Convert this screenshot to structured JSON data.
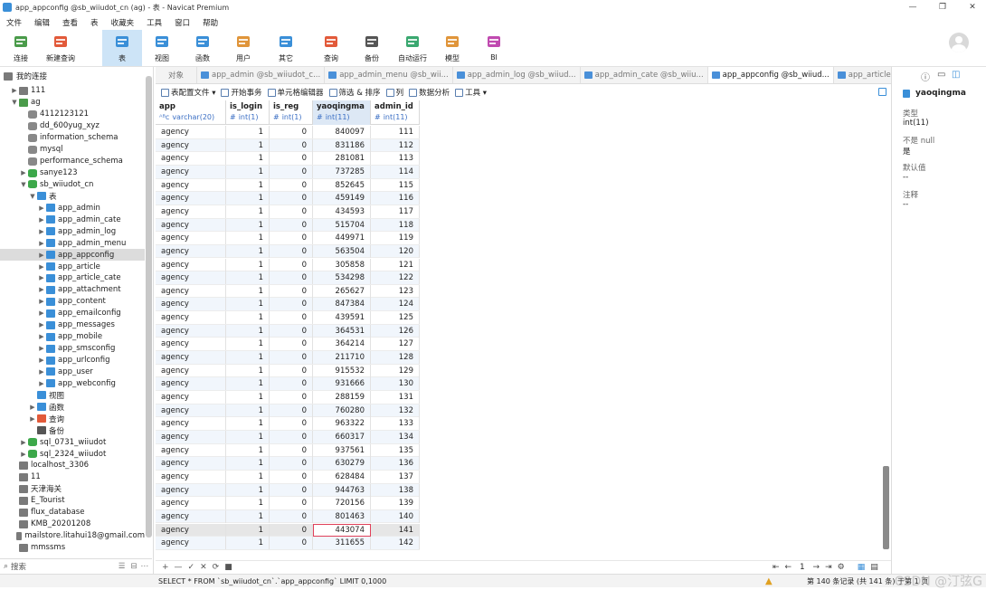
{
  "window": {
    "title": "app_appconfig @sb_wiiudot_cn (ag) - 表 - Navicat Premium"
  },
  "menu": [
    "文件",
    "编辑",
    "查看",
    "表",
    "收藏夹",
    "工具",
    "窗口",
    "帮助"
  ],
  "toolbar": [
    {
      "label": "连接",
      "icon": "connection-icon",
      "color": "#4a9b4a"
    },
    {
      "label": "新建查询",
      "icon": "new-query-icon",
      "color": "#e25a3a"
    },
    {
      "label": "表",
      "icon": "table-icon",
      "color": "#3a8fd8"
    },
    {
      "label": "视图",
      "icon": "view-icon",
      "color": "#3a8fd8"
    },
    {
      "label": "函数",
      "icon": "function-icon",
      "color": "#3a8fd8"
    },
    {
      "label": "用户",
      "icon": "user-icon",
      "color": "#e0953a"
    },
    {
      "label": "其它",
      "icon": "tools-icon",
      "color": "#3a8fd8"
    },
    {
      "label": "查询",
      "icon": "query-icon",
      "color": "#e25a3a"
    },
    {
      "label": "备份",
      "icon": "backup-icon",
      "color": "#555555"
    },
    {
      "label": "自动运行",
      "icon": "robot-icon",
      "color": "#3aa870"
    },
    {
      "label": "模型",
      "icon": "model-icon",
      "color": "#e0953a"
    },
    {
      "label": "BI",
      "icon": "bi-icon",
      "color": "#c04ab0"
    }
  ],
  "sidebar": {
    "header": "我的连接",
    "search_placeholder": "搜索",
    "nodes": [
      {
        "label": "111",
        "indent": 0,
        "arrow": "▶",
        "icon": "conn",
        "color": "#7a7a7a"
      },
      {
        "label": "ag",
        "indent": 0,
        "arrow": "▼",
        "icon": "conn",
        "color": "#4a9b4a"
      },
      {
        "label": "4112123121",
        "indent": 1,
        "arrow": "",
        "icon": "db",
        "color": "#888"
      },
      {
        "label": "dd_600yug_xyz",
        "indent": 1,
        "arrow": "",
        "icon": "db",
        "color": "#888"
      },
      {
        "label": "information_schema",
        "indent": 1,
        "arrow": "",
        "icon": "db",
        "color": "#888"
      },
      {
        "label": "mysql",
        "indent": 1,
        "arrow": "",
        "icon": "db",
        "color": "#888"
      },
      {
        "label": "performance_schema",
        "indent": 1,
        "arrow": "",
        "icon": "db",
        "color": "#888"
      },
      {
        "label": "sanye123",
        "indent": 1,
        "arrow": "▶",
        "icon": "db",
        "color": "#3ca84a"
      },
      {
        "label": "sb_wiiudot_cn",
        "indent": 1,
        "arrow": "▼",
        "icon": "db",
        "color": "#3ca84a"
      },
      {
        "label": "表",
        "indent": 2,
        "arrow": "▼",
        "icon": "folder",
        "color": "#3a8fd8"
      },
      {
        "label": "app_admin",
        "indent": 3,
        "arrow": "▶",
        "icon": "table",
        "color": "#3a8fd8"
      },
      {
        "label": "app_admin_cate",
        "indent": 3,
        "arrow": "▶",
        "icon": "table",
        "color": "#3a8fd8"
      },
      {
        "label": "app_admin_log",
        "indent": 3,
        "arrow": "▶",
        "icon": "table",
        "color": "#3a8fd8"
      },
      {
        "label": "app_admin_menu",
        "indent": 3,
        "arrow": "▶",
        "icon": "table",
        "color": "#3a8fd8"
      },
      {
        "label": "app_appconfig",
        "indent": 3,
        "arrow": "▶",
        "icon": "table",
        "color": "#3a8fd8",
        "selected": true
      },
      {
        "label": "app_article",
        "indent": 3,
        "arrow": "▶",
        "icon": "table",
        "color": "#3a8fd8"
      },
      {
        "label": "app_article_cate",
        "indent": 3,
        "arrow": "▶",
        "icon": "table",
        "color": "#3a8fd8"
      },
      {
        "label": "app_attachment",
        "indent": 3,
        "arrow": "▶",
        "icon": "table",
        "color": "#3a8fd8"
      },
      {
        "label": "app_content",
        "indent": 3,
        "arrow": "▶",
        "icon": "table",
        "color": "#3a8fd8"
      },
      {
        "label": "app_emailconfig",
        "indent": 3,
        "arrow": "▶",
        "icon": "table",
        "color": "#3a8fd8"
      },
      {
        "label": "app_messages",
        "indent": 3,
        "arrow": "▶",
        "icon": "table",
        "color": "#3a8fd8"
      },
      {
        "label": "app_mobile",
        "indent": 3,
        "arrow": "▶",
        "icon": "table",
        "color": "#3a8fd8"
      },
      {
        "label": "app_smsconfig",
        "indent": 3,
        "arrow": "▶",
        "icon": "table",
        "color": "#3a8fd8"
      },
      {
        "label": "app_urlconfig",
        "indent": 3,
        "arrow": "▶",
        "icon": "table",
        "color": "#3a8fd8"
      },
      {
        "label": "app_user",
        "indent": 3,
        "arrow": "▶",
        "icon": "table",
        "color": "#3a8fd8"
      },
      {
        "label": "app_webconfig",
        "indent": 3,
        "arrow": "▶",
        "icon": "table",
        "color": "#3a8fd8"
      },
      {
        "label": "视图",
        "indent": 2,
        "arrow": "",
        "icon": "view",
        "color": "#3a8fd8"
      },
      {
        "label": "函数",
        "indent": 2,
        "arrow": "▶",
        "icon": "func",
        "color": "#3a8fd8"
      },
      {
        "label": "查询",
        "indent": 2,
        "arrow": "▶",
        "icon": "query",
        "color": "#e25a3a"
      },
      {
        "label": "备份",
        "indent": 2,
        "arrow": "",
        "icon": "backup",
        "color": "#555"
      },
      {
        "label": "sql_0731_wiiudot",
        "indent": 1,
        "arrow": "▶",
        "icon": "db",
        "color": "#3ca84a"
      },
      {
        "label": "sql_2324_wiiudot",
        "indent": 1,
        "arrow": "▶",
        "icon": "db",
        "color": "#3ca84a"
      },
      {
        "label": "localhost_3306",
        "indent": 0,
        "arrow": "",
        "icon": "conn",
        "color": "#7a7a7a"
      },
      {
        "label": "11",
        "indent": 0,
        "arrow": "",
        "icon": "conn",
        "color": "#7a7a7a"
      },
      {
        "label": "天津海关",
        "indent": 0,
        "arrow": "",
        "icon": "conn",
        "color": "#7a7a7a"
      },
      {
        "label": "E_Tourist",
        "indent": 0,
        "arrow": "",
        "icon": "conn",
        "color": "#7a7a7a"
      },
      {
        "label": "flux_database",
        "indent": 0,
        "arrow": "",
        "icon": "conn",
        "color": "#7a7a7a"
      },
      {
        "label": "KMB_20201208",
        "indent": 0,
        "arrow": "",
        "icon": "conn",
        "color": "#7a7a7a"
      },
      {
        "label": "mailstore.litahui18@gmail.com",
        "indent": 0,
        "arrow": "",
        "icon": "conn",
        "color": "#7a7a7a"
      },
      {
        "label": "mmssms",
        "indent": 0,
        "arrow": "",
        "icon": "conn",
        "color": "#7a7a7a"
      }
    ]
  },
  "tabs": [
    {
      "label": "对象",
      "active": false,
      "icon": false
    },
    {
      "label": "app_admin @sb_wiiudot_c...",
      "active": false,
      "icon": true
    },
    {
      "label": "app_admin_menu @sb_wii...",
      "active": false,
      "icon": true
    },
    {
      "label": "app_admin_log @sb_wiiud...",
      "active": false,
      "icon": true
    },
    {
      "label": "app_admin_cate @sb_wiiu...",
      "active": false,
      "icon": true
    },
    {
      "label": "app_appconfig @sb_wiiud...",
      "active": true,
      "icon": true
    },
    {
      "label": "app_article @sb_wiiudot_c...",
      "active": false,
      "icon": true
    }
  ],
  "subtoolbar": [
    "表配置文件 ▾",
    "开始事务",
    "单元格编辑器",
    "筛选 & 排序",
    "列",
    "数据分析",
    "工具 ▾"
  ],
  "columns": [
    {
      "name": "app",
      "type": "varchar(20)",
      "type_prefix": "ᴬᴮc"
    },
    {
      "name": "is_login",
      "type": "int(1)",
      "type_prefix": "#"
    },
    {
      "name": "is_reg",
      "type": "int(1)",
      "type_prefix": "#"
    },
    {
      "name": "yaoqingma",
      "type": "int(11)",
      "type_prefix": "#",
      "selected": true
    },
    {
      "name": "admin_id",
      "type": "int(11)",
      "type_prefix": "#"
    }
  ],
  "rows": [
    [
      "agency",
      "1",
      "0",
      "840097",
      "111"
    ],
    [
      "agency",
      "1",
      "0",
      "831186",
      "112"
    ],
    [
      "agency",
      "1",
      "0",
      "281081",
      "113"
    ],
    [
      "agency",
      "1",
      "0",
      "737285",
      "114"
    ],
    [
      "agency",
      "1",
      "0",
      "852645",
      "115"
    ],
    [
      "agency",
      "1",
      "0",
      "459149",
      "116"
    ],
    [
      "agency",
      "1",
      "0",
      "434593",
      "117"
    ],
    [
      "agency",
      "1",
      "0",
      "515704",
      "118"
    ],
    [
      "agency",
      "1",
      "0",
      "449971",
      "119"
    ],
    [
      "agency",
      "1",
      "0",
      "563504",
      "120"
    ],
    [
      "agency",
      "1",
      "0",
      "305858",
      "121"
    ],
    [
      "agency",
      "1",
      "0",
      "534298",
      "122"
    ],
    [
      "agency",
      "1",
      "0",
      "265627",
      "123"
    ],
    [
      "agency",
      "1",
      "0",
      "847384",
      "124"
    ],
    [
      "agency",
      "1",
      "0",
      "439591",
      "125"
    ],
    [
      "agency",
      "1",
      "0",
      "364531",
      "126"
    ],
    [
      "agency",
      "1",
      "0",
      "364214",
      "127"
    ],
    [
      "agency",
      "1",
      "0",
      "211710",
      "128"
    ],
    [
      "agency",
      "1",
      "0",
      "915532",
      "129"
    ],
    [
      "agency",
      "1",
      "0",
      "931666",
      "130"
    ],
    [
      "agency",
      "1",
      "0",
      "288159",
      "131"
    ],
    [
      "agency",
      "1",
      "0",
      "760280",
      "132"
    ],
    [
      "agency",
      "1",
      "0",
      "963322",
      "133"
    ],
    [
      "agency",
      "1",
      "0",
      "660317",
      "134"
    ],
    [
      "agency",
      "1",
      "0",
      "937561",
      "135"
    ],
    [
      "agency",
      "1",
      "0",
      "630279",
      "136"
    ],
    [
      "agency",
      "1",
      "0",
      "628484",
      "137"
    ],
    [
      "agency",
      "1",
      "0",
      "944763",
      "138"
    ],
    [
      "agency",
      "1",
      "0",
      "720156",
      "139"
    ],
    [
      "agency",
      "1",
      "0",
      "801463",
      "140"
    ],
    [
      "agency",
      "1",
      "0",
      "443074",
      "141"
    ],
    [
      "agency",
      "1",
      "0",
      "311655",
      "142"
    ]
  ],
  "current_row_index": 30,
  "editing_cell": {
    "row": 30,
    "col": 3
  },
  "grid_bottom": {
    "left_buttons": [
      "+",
      "—",
      "✓",
      "✕",
      "⟳",
      "■"
    ],
    "page_value": "1"
  },
  "right_panel": {
    "field_name": "yaoqingma",
    "type_label": "类型",
    "type_value": "int(11)",
    "null_label": "不是 null",
    "null_value": "是",
    "default_label": "默认值",
    "default_value": "--",
    "comment_label": "注释",
    "comment_value": "--"
  },
  "statusbar": {
    "sql": "SELECT * FROM `sb_wiiudot_cn`.`app_appconfig` LIMIT 0,1000",
    "record_info": "第 140 条记录 (共 141 条) 于第 1 页",
    "watermark": "CSDN @汀弦G"
  },
  "colors": {
    "accent": "#3a8fd8",
    "selection": "#cde4f7",
    "edit_outline": "#e0405a",
    "row_alt": "#f1f6fc"
  }
}
